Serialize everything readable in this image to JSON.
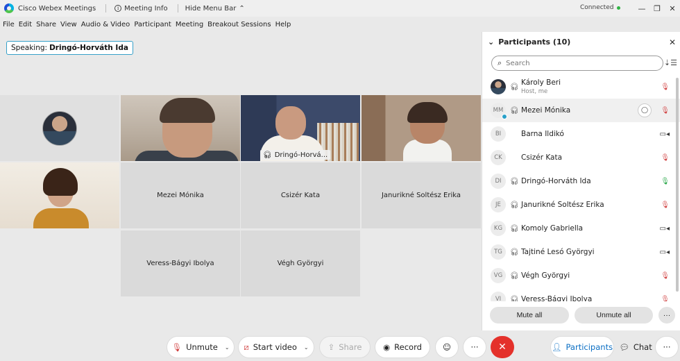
{
  "window": {
    "app_title": "Cisco Webex Meetings",
    "meeting_info": "Meeting Info",
    "hide_menu_bar": "Hide Menu Bar",
    "status": "Connected",
    "status_color": "#2fb344"
  },
  "menu": [
    "File",
    "Edit",
    "Share",
    "View",
    "Audio & Video",
    "Participant",
    "Meeting",
    "Breakout Sessions",
    "Help"
  ],
  "speaking": {
    "label": "Speaking:",
    "name": "Dringó-Horváth Ida"
  },
  "tiles": {
    "mezei": "Mezei Mónika",
    "csizer": "Csizér Kata",
    "januri": "Janurikné Soltész Erika",
    "veress": "Veress-Bágyi Ibolya",
    "vegh": "Végh Györgyi",
    "active_tag": "Dringó-Horvá..."
  },
  "participants": {
    "title": "Participants (10)",
    "search_placeholder": "Search",
    "list": [
      {
        "initials": "",
        "name": "Károly Beri",
        "sub": "Host, me",
        "icon": "mic-off"
      },
      {
        "initials": "MM",
        "name": "Mezei Mónika",
        "icon": "mic-off",
        "chat": true
      },
      {
        "initials": "BI",
        "name": "Barna Ildikó",
        "icon": "camera"
      },
      {
        "initials": "CK",
        "name": "Csizér Kata",
        "icon": "mic-off"
      },
      {
        "initials": "DI",
        "name": "Dringó-Horváth Ida",
        "icon": "mic-on"
      },
      {
        "initials": "JE",
        "name": "Janurikné Soltész Erika",
        "icon": "mic-off"
      },
      {
        "initials": "KG",
        "name": "Komoly Gabriella",
        "icon": "camera"
      },
      {
        "initials": "TG",
        "name": "Tajtiné Lesó Györgyi",
        "icon": "camera"
      },
      {
        "initials": "VG",
        "name": "Végh Györgyi",
        "icon": "mic-off"
      },
      {
        "initials": "VI",
        "name": "Veress-Bágyi Ibolya",
        "icon": "mic-off"
      }
    ],
    "mute_all": "Mute all",
    "unmute_all": "Unmute all"
  },
  "toolbar": {
    "unmute": "Unmute",
    "start_video": "Start video",
    "share": "Share",
    "record": "Record",
    "participants": "Participants",
    "chat": "Chat"
  },
  "colors": {
    "accent": "#1ea4e4",
    "end": "#e4312b",
    "mic_off": "#d24545"
  }
}
